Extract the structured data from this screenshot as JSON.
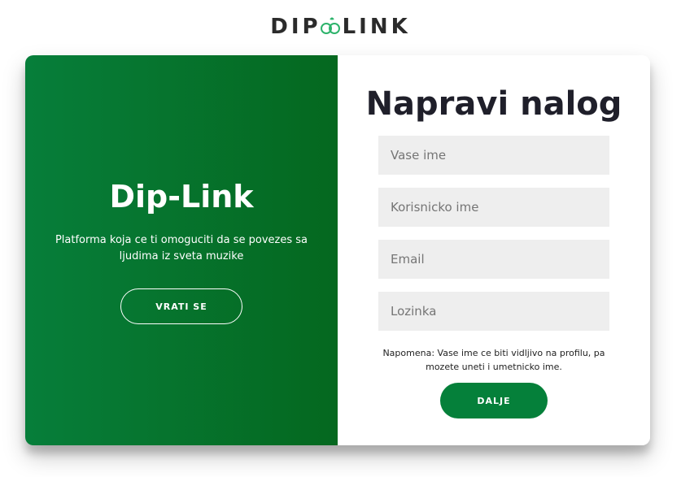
{
  "brand": {
    "logo_left": "DIP",
    "logo_right": "LINK",
    "logo_icon": "link-chain-icon",
    "accent": "#05803a",
    "icon_color": "#2db36b"
  },
  "left_panel": {
    "title": "Dip-Link",
    "description": "Platforma koja ce ti omoguciti da se povezes sa ljudima iz sveta muzike",
    "back_button": "VRATI SE",
    "gradient_start": "#067e3a",
    "gradient_end": "#05681f"
  },
  "signup_form": {
    "title": "Napravi nalog",
    "name_placeholder": "Vase ime",
    "username_placeholder": "Korisnicko ime",
    "email_placeholder": "Email",
    "password_placeholder": "Lozinka",
    "note": "Napomena: Vase ime ce biti vidljivo na profilu, pa mozete uneti i umetnicko ime.",
    "submit_button": "DALJE"
  }
}
